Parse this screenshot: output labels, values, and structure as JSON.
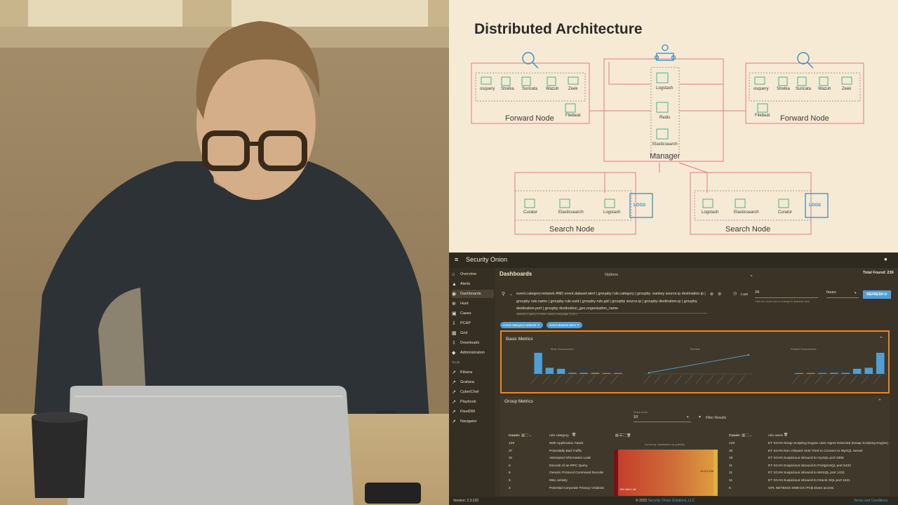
{
  "diagram": {
    "title": "Distributed Architecture",
    "forward_node_label": "Forward Node",
    "manager_label": "Manager",
    "search_node_label": "Search Node",
    "forward_components": [
      "osquery",
      "Strelka",
      "Suricata",
      "Wazuh",
      "Zeek"
    ],
    "filebeat_label": "Filebeat",
    "manager_components": [
      "Logstash",
      "Redis",
      "Elasticsearch"
    ],
    "search_components_left": [
      "Curator",
      "Elasticsearch",
      "Logstash"
    ],
    "search_components_right": [
      "Logstash",
      "Elasticsearch",
      "Curator"
    ],
    "logs_label": "LOGS"
  },
  "dashboard": {
    "brand": "Security Onion",
    "page_title": "Dashboards",
    "options_label": "Options",
    "total_found": "Total Found: 239",
    "query_text": "event.category:network AND event.dataset:alert | groupby rule.category | groupby -sankey source.ip destination.ip | groupby rule.name | groupby rule.uuid | groupby rule.gid | groupby source.ip | groupby destination.ip | groupby destination.port | groupby destination_geo.organization_name",
    "query_hint": "Specify a query in Onion Query Language (OQL)",
    "last_label": "Last",
    "last_value": "24",
    "unit_value": "hours",
    "clock_hint": "Click the clock icon to change to absolute time",
    "refresh_label": "REFRESH",
    "chips": [
      "event.category:network",
      "event.dataset:alert"
    ],
    "basic_metrics": "Basic Metrics",
    "most_occurrences": "Most Occurrences",
    "timeline": "Timeline",
    "fewest_occurrences": "Fewest Occurrences",
    "group_metrics": "Group Metrics",
    "fetch_limit_label": "Fetch Limit",
    "fetch_limit_value": "10",
    "filter_results": "Filter Results",
    "left_table": {
      "header_count": "Count",
      "header_field": "rule.category",
      "rows": [
        {
          "count": "129",
          "value": "Web Application Attack"
        },
        {
          "count": "37",
          "value": "Potentially Bad Traffic"
        },
        {
          "count": "31",
          "value": "Attempted Information Leak"
        },
        {
          "count": "6",
          "value": "Decode of an RPC Query"
        },
        {
          "count": "6",
          "value": "Generic Protocol Command Decode"
        },
        {
          "count": "6",
          "value": "Misc activity"
        },
        {
          "count": "4",
          "value": "Potential Corporate Privacy Violation"
        }
      ]
    },
    "sankey_title": "source.ip, destination.ip (partial)",
    "sankey_left_label": "192.168.1.16",
    "sankey_right_label": "10.0.0.106",
    "right_table": {
      "header_count": "Count",
      "header_field": "rule.name",
      "rows": [
        {
          "count": "129",
          "value": "ET SCAN Nmap Scripting Engine User-Agent Detected (Nmap Scripting Engine)"
        },
        {
          "count": "20",
          "value": "ET SCAN Non-Allowed Host Tried to Connect to MySQL Server"
        },
        {
          "count": "19",
          "value": "ET SCAN Suspicious inbound to mySQL port 3306"
        },
        {
          "count": "11",
          "value": "ET SCAN Suspicious inbound to PostgreSQL port 5432"
        },
        {
          "count": "11",
          "value": "ET SCAN Suspicious inbound to MSSQL port 1433"
        },
        {
          "count": "11",
          "value": "ET SCAN Suspicious inbound to Oracle SQL port 1521"
        },
        {
          "count": "6",
          "value": "GPL NETBIOS SMB-DS IPC$ share access"
        }
      ]
    },
    "version": "Version: 2.3.220",
    "copyright_prefix": "© 2023 ",
    "copyright_link": "Security Onion Solutions, LLC",
    "terms": "Terms and Conditions",
    "nav": [
      {
        "label": "Overview",
        "icon": "home-icon"
      },
      {
        "label": "Alerts",
        "icon": "bell-icon"
      },
      {
        "label": "Dashboards",
        "icon": "dashboard-icon"
      },
      {
        "label": "Hunt",
        "icon": "crosshair-icon"
      },
      {
        "label": "Cases",
        "icon": "briefcase-icon"
      },
      {
        "label": "PCAP",
        "icon": "download-icon"
      },
      {
        "label": "Grid",
        "icon": "grid-icon"
      },
      {
        "label": "Downloads",
        "icon": "download-icon"
      },
      {
        "label": "Administration",
        "icon": "shield-icon"
      }
    ],
    "tools_label": "Tools",
    "tools": [
      "Kibana",
      "Grafana",
      "CyberChef",
      "Playbook",
      "FleetDM",
      "Navigator"
    ],
    "accent": "#4f9fd6",
    "highlight_border": "#e8872a"
  },
  "chart_data": [
    {
      "type": "bar",
      "title": "Most Occurrences",
      "values": [
        129,
        37,
        31,
        6,
        6,
        6,
        4,
        4
      ]
    },
    {
      "type": "line",
      "title": "Timeline",
      "values": [
        10,
        180
      ]
    },
    {
      "type": "bar",
      "title": "Fewest Occurrences",
      "values": [
        4,
        4,
        4,
        6,
        6,
        31,
        37,
        129
      ]
    }
  ]
}
